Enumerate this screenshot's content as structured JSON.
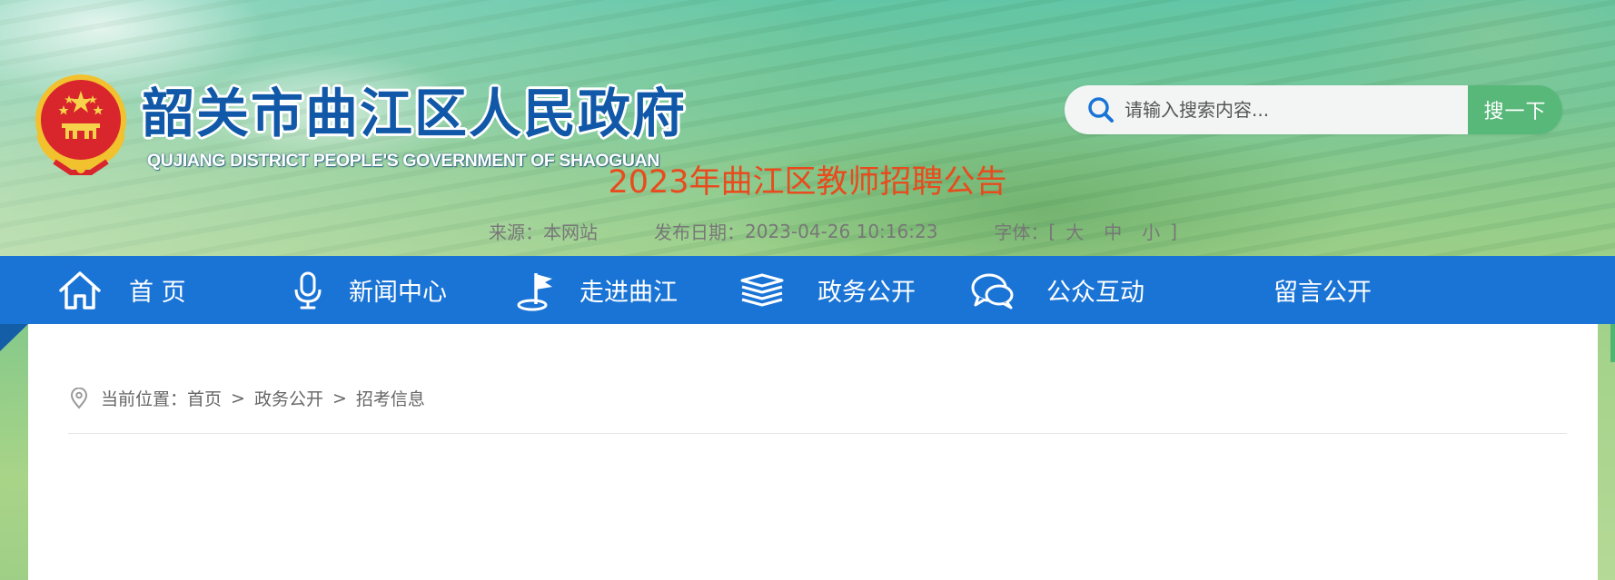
{
  "header": {
    "title": "韶关市曲江区人民政府",
    "subtitle": "QUJIANG DISTRICT PEOPLE'S GOVERNMENT OF SHAOGUAN"
  },
  "search": {
    "placeholder": "请输入搜索内容...",
    "button_label": "搜一下",
    "accent_color": "#58b87a"
  },
  "nav": {
    "background_color": "#1a74d6",
    "items": [
      {
        "label": "首 页",
        "icon": "home-icon"
      },
      {
        "label": "新闻中心",
        "icon": "microphone-icon"
      },
      {
        "label": "走进曲江",
        "icon": "flag-icon"
      },
      {
        "label": "政务公开",
        "icon": "layers-icon"
      },
      {
        "label": "公众互动",
        "icon": "chat-bubbles-icon"
      },
      {
        "label": "留言公开",
        "icon": ""
      }
    ]
  },
  "breadcrumb": {
    "icon": "location-pin-icon",
    "prefix": "当前位置：",
    "items": [
      "首页",
      "政务公开",
      "招考信息"
    ],
    "separator": ">"
  },
  "article": {
    "title": "2023年曲江区教师招聘公告",
    "title_color": "#e84b1d",
    "source_label": "来源：",
    "source_value": "本网站",
    "date_label": "发布日期：",
    "date_value": "2023-04-26 10:16:23",
    "font_label": "字体：",
    "font_bracket_open": "[",
    "font_sizes": [
      "大",
      "中",
      "小"
    ],
    "font_bracket_close": "]"
  }
}
